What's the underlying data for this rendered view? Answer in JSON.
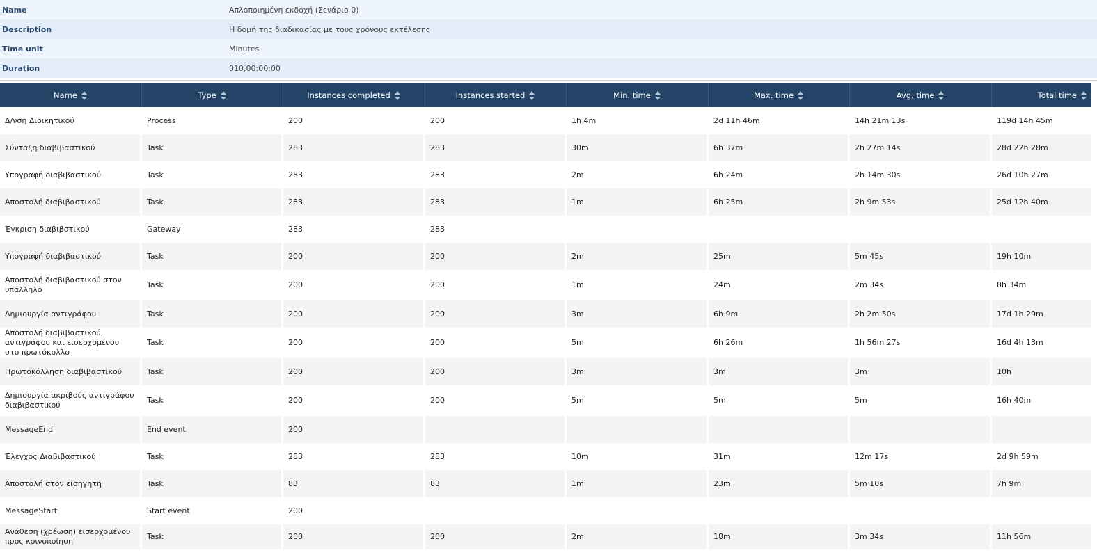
{
  "properties": [
    {
      "label": "Name",
      "value": "Απλοποιημένη εκδοχή (Σενάριο 0)"
    },
    {
      "label": "Description",
      "value": "Η δομή της διαδικασίας με τους χρόνους εκτέλεσης"
    },
    {
      "label": "Time unit",
      "value": "Minutes"
    },
    {
      "label": "Duration",
      "value": "010,00:00:00"
    }
  ],
  "table": {
    "columns": [
      "Name",
      "Type",
      "Instances completed",
      "Instances started",
      "Min. time",
      "Max. time",
      "Avg. time",
      "Total time"
    ],
    "rows": [
      [
        "Δ/νση Διοικητικού",
        "Process",
        "200",
        "200",
        "1h 4m",
        "2d 11h 46m",
        "14h 21m 13s",
        "119d 14h 45m"
      ],
      [
        "Σύνταξη διαβιβαστικού",
        "Task",
        "283",
        "283",
        "30m",
        "6h 37m",
        "2h 27m 14s",
        "28d 22h 28m"
      ],
      [
        "Υπογραφή διαβιβαστικού",
        "Task",
        "283",
        "283",
        "2m",
        "6h 24m",
        "2h 14m 30s",
        "26d 10h 27m"
      ],
      [
        "Αποστολή διαβιβαστικού",
        "Task",
        "283",
        "283",
        "1m",
        "6h 25m",
        "2h 9m 53s",
        "25d 12h 40m"
      ],
      [
        "Έγκριση διαβιβστικού",
        "Gateway",
        "283",
        "283",
        "",
        "",
        "",
        ""
      ],
      [
        "Υπογραφή διαβιβαστικού",
        "Task",
        "200",
        "200",
        "2m",
        "25m",
        "5m 45s",
        "19h 10m"
      ],
      [
        "Αποστολή διαβιβαστικού στον υπάλληλο",
        "Task",
        "200",
        "200",
        "1m",
        "24m",
        "2m 34s",
        "8h 34m"
      ],
      [
        "Δημιουργία αντιγράφου",
        "Task",
        "200",
        "200",
        "3m",
        "6h 9m",
        "2h 2m 50s",
        "17d 1h 29m"
      ],
      [
        "Αποστολή διαβιβαστικού, αντιγράφου και εισερχομένου στο πρωτόκολλο",
        "Task",
        "200",
        "200",
        "5m",
        "6h 26m",
        "1h 56m 27s",
        "16d 4h 13m"
      ],
      [
        "Πρωτοκόλληση διαβιβαστικού",
        "Task",
        "200",
        "200",
        "3m",
        "3m",
        "3m",
        "10h"
      ],
      [
        "Δημιουργία ακριβούς αντιγράφου διαβιβαστικού",
        "Task",
        "200",
        "200",
        "5m",
        "5m",
        "5m",
        "16h 40m"
      ],
      [
        "MessageEnd",
        "End event",
        "200",
        "",
        "",
        "",
        "",
        ""
      ],
      [
        "Έλεγχος Διαβιβαστικού",
        "Task",
        "283",
        "283",
        "10m",
        "31m",
        "12m 17s",
        "2d 9h 59m"
      ],
      [
        "Αποστολή στον εισηγητή",
        "Task",
        "83",
        "83",
        "1m",
        "23m",
        "5m 10s",
        "7h 9m"
      ],
      [
        "MessageStart",
        "Start event",
        "200",
        "",
        "",
        "",
        "",
        ""
      ],
      [
        "Ανάθεση (χρέωση) εισερχομένου προς κοινοποίηση",
        "Task",
        "200",
        "200",
        "2m",
        "18m",
        "3m 34s",
        "11h 56m"
      ]
    ]
  }
}
